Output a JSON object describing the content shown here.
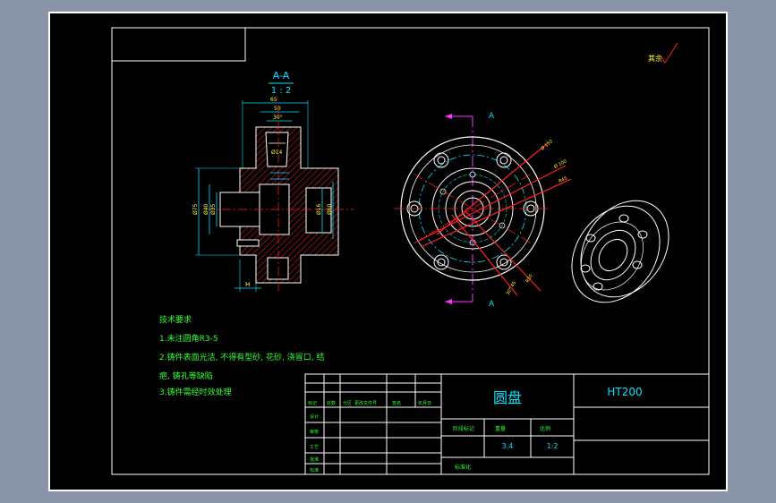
{
  "section": {
    "label": "A-A",
    "scale": "1 : 2"
  },
  "section_marks": {
    "top": "A",
    "bottom": "A"
  },
  "dims_left": {
    "phi75": "Ø75",
    "phi40": "Ø40",
    "phi35": "Ø35",
    "phi14": "Ø14",
    "h": "H",
    "phi16": "Ø16",
    "phi60": "Ø60"
  },
  "dims_top": {
    "d65": "65",
    "d50": "50",
    "d30": "30°"
  },
  "dims_circle": {
    "a": "Ø 150",
    "b": "Ø 100",
    "c": "R45",
    "d": "R50",
    "e": "30° 45"
  },
  "roughness": {
    "label": "其余"
  },
  "tech": {
    "title": "技术要求",
    "l1": "1.未注圆角R3-5",
    "l2": "2.铸件表面光洁, 不得有型砂, 花砂, 浇冒口, 结",
    "l3": "疤, 铸孔等缺陷",
    "l4": "3.铸件需经时效处理"
  },
  "title_block": {
    "part_name": "圆盘",
    "material": "HT200",
    "h_mark": "阶段标记",
    "h_weight": "重量",
    "h_scale": "比例",
    "weight": "3.4",
    "scale": "1:2",
    "drawing_no": "标准化",
    "r1": "标记",
    "r2": "处数",
    "r3": "分区",
    "r4": "更改文件号",
    "r5": "签名",
    "r6": "年月日",
    "row_design": "设计",
    "row_check": "审核",
    "row_process": "工艺",
    "row_approve": "批准",
    "row_std": "标准"
  },
  "colors": {
    "bg": "#000000",
    "frame": "#ffffff",
    "red": "#ff2020",
    "cyan": "#00e5ff",
    "yellow": "#ffff33",
    "green": "#33ff33",
    "magenta": "#ff33ff"
  }
}
